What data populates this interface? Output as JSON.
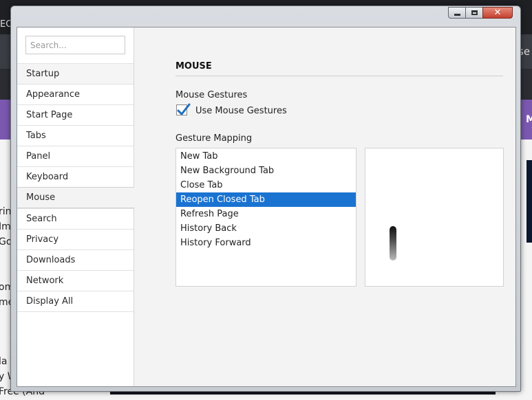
{
  "background": {
    "topbar_text": "EC",
    "right_text": "se",
    "right_letter": "M",
    "left_texts": [
      "rin",
      "Im",
      "Goo",
      "om",
      "me",
      "la T",
      "y W",
      "Free (And"
    ]
  },
  "window": {
    "controls": {
      "minimize": "minimize-icon",
      "maximize": "maximize-icon",
      "close": "close-icon"
    }
  },
  "sidebar": {
    "search_placeholder": "Search...",
    "items": [
      {
        "label": "Startup"
      },
      {
        "label": "Appearance"
      },
      {
        "label": "Start Page"
      },
      {
        "label": "Tabs"
      },
      {
        "label": "Panel"
      },
      {
        "label": "Keyboard"
      },
      {
        "label": "Mouse"
      },
      {
        "label": "Search"
      },
      {
        "label": "Privacy"
      },
      {
        "label": "Downloads"
      },
      {
        "label": "Network"
      },
      {
        "label": "Display All"
      }
    ],
    "active_index": 6
  },
  "main": {
    "section_title": "MOUSE",
    "gestures_heading": "Mouse Gestures",
    "use_gestures_label": "Use Mouse Gestures",
    "use_gestures_checked": true,
    "mapping_heading": "Gesture Mapping",
    "mapping_items": [
      {
        "label": "New Tab"
      },
      {
        "label": "New Background Tab"
      },
      {
        "label": "Close Tab"
      },
      {
        "label": "Reopen Closed Tab"
      },
      {
        "label": "Refresh Page"
      },
      {
        "label": "History Back"
      },
      {
        "label": "History Forward"
      }
    ],
    "selected_mapping_index": 3
  },
  "colors": {
    "selection": "#1a73d1",
    "checkmark": "#1f6fbf"
  }
}
